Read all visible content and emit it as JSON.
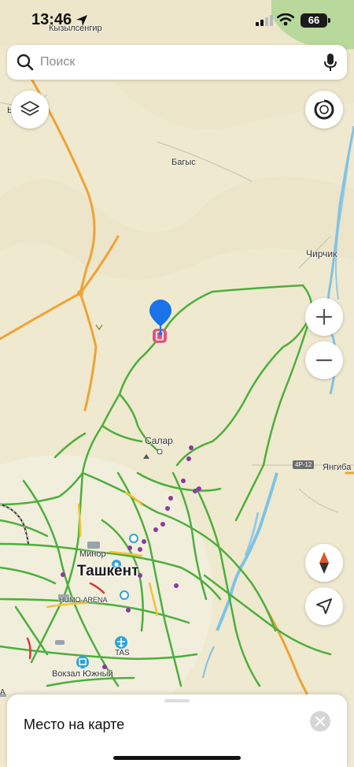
{
  "status_bar": {
    "time": "13:46",
    "battery": "66"
  },
  "search": {
    "placeholder": "Поиск"
  },
  "map": {
    "labels": {
      "kyzylsengir": "Кызылсенгир",
      "bagys": "Багыс",
      "chirchik": "Чирчик",
      "salar": "Салар",
      "yangibad": "Янгиба",
      "minor": "Минор",
      "tashkent": "Ташкент",
      "humo_arena": "HUMO-ARENA",
      "tas": "TAS",
      "vokzal": "Вокзал Южный",
      "road_4r12": "4Р-12",
      "edge_a": "Ы",
      "edge_b": "А"
    }
  },
  "sheet": {
    "title": "Место на карте"
  },
  "colors": {
    "land": "#efe9cf",
    "traffic_green": "#4caf3c",
    "traffic_yellow": "#f1c232",
    "highway_orange": "#f0a235",
    "pin_blue": "#1a73e8",
    "marker_pink": "#e0557c",
    "poi_purple": "#8b3a9e",
    "water": "#7fc3e6"
  },
  "icons": {
    "search": "search-icon",
    "mic": "mic-icon",
    "layers": "layers-icon",
    "compass": "compass-ring-icon",
    "zoom_in": "plus-icon",
    "zoom_out": "minus-icon",
    "north": "north-arrow-icon",
    "locate": "location-arrow-icon",
    "close": "close-icon"
  }
}
